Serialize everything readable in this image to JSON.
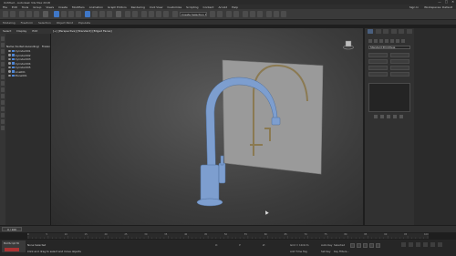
{
  "window": {
    "title": "Untitled - Autodesk 3ds Max 2018",
    "buttons": [
      "—",
      "□",
      "✕"
    ]
  },
  "menu": {
    "items": [
      "File",
      "Edit",
      "Tools",
      "Group",
      "Views",
      "Create",
      "Modifiers",
      "Animation",
      "Graph Editors",
      "Rendering",
      "Civil View",
      "Customize",
      "Scripting",
      "Content",
      "Arnold",
      "Help"
    ],
    "sign_in": "Sign In",
    "workspace": "Workspaces: Default"
  },
  "toolbar": {
    "selection_set": "Create Selection Se"
  },
  "ribbon": {
    "tabs": [
      "Modeling",
      "Freeform",
      "Selection",
      "Object Paint",
      "Populate"
    ]
  },
  "scene_explorer": {
    "tabs": [
      "Select",
      "Display",
      "Edit"
    ],
    "header": "Name (Sorted Ascending)",
    "header_extra": "Frozen",
    "rows": [
      {
        "label": "Cylinder001"
      },
      {
        "label": "Cylinder002"
      },
      {
        "label": "Cylinder003"
      },
      {
        "label": "Cylinder004"
      },
      {
        "label": "Cylinder005"
      },
      {
        "label": "Line001"
      },
      {
        "label": "Plane001"
      }
    ]
  },
  "viewport": {
    "label": "[+] [Perspective] [Standard] [Edged Faces]"
  },
  "command_panel": {
    "dropdown": "Standard Primitives",
    "icons": [
      "create-icon",
      "modify-icon",
      "hierarchy-icon",
      "motion-icon",
      "display-icon",
      "utilities-icon"
    ]
  },
  "timeline": {
    "frame": "0 / 100",
    "ticks": [
      "0",
      "5",
      "10",
      "15",
      "20",
      "25",
      "30",
      "35",
      "40",
      "45",
      "50",
      "55",
      "60",
      "65",
      "70",
      "75",
      "80",
      "85",
      "90",
      "95",
      "100"
    ]
  },
  "status": {
    "maxscript": "MAXScript Mi",
    "message1": "None Selected",
    "message2": "Click and drag to select and move objects",
    "x_label": "X:",
    "y_label": "Y:",
    "z_label": "Z:",
    "grid": "Grid = 10.0cm",
    "add_time_tag": "Add Time Tag",
    "auto_key": "Auto Key",
    "selected": "Selected",
    "set_key": "Set Key",
    "key_filters": "Key Filters..."
  },
  "colors": {
    "accent": "#3f77c7",
    "faucet": "#7d9ecf",
    "backdrop": "#9a9a9a",
    "sketch": "#8b7a52"
  }
}
